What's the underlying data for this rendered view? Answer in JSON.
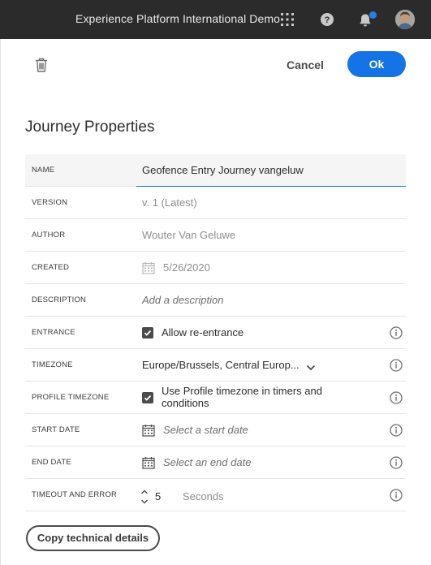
{
  "header": {
    "org_name": "Experience Platform International Demo",
    "icons": [
      "apps-icon",
      "help-icon",
      "bell-icon",
      "avatar"
    ],
    "notification_badge_color": "#2680eb"
  },
  "toolbar": {
    "delete_icon": "trash-icon",
    "cancel_label": "Cancel",
    "ok_label": "Ok",
    "accent_color": "#1473e6"
  },
  "page_title": "Journey Properties",
  "properties": {
    "name": {
      "label": "NAME",
      "value": "Geofence Entry Journey vangeluw"
    },
    "version": {
      "label": "VERSION",
      "value": "v. 1 (Latest)"
    },
    "author": {
      "label": "AUTHOR",
      "value": "Wouter Van Geluwe"
    },
    "created": {
      "label": "CREATED",
      "value": "5/26/2020"
    },
    "description": {
      "label": "DESCRIPTION",
      "placeholder": "Add a description"
    },
    "entrance": {
      "label": "ENTRANCE",
      "checkbox_label": "Allow re-entrance",
      "checked": true
    },
    "timezone": {
      "label": "TIMEZONE",
      "value": "Europe/Brussels, Central Europ..."
    },
    "profile_timezone": {
      "label": "PROFILE TIMEZONE",
      "checkbox_label": "Use Profile timezone in timers and conditions",
      "checked": true
    },
    "start_date": {
      "label": "START DATE",
      "placeholder": "Select a start date"
    },
    "end_date": {
      "label": "END DATE",
      "placeholder": "Select an end date"
    },
    "timeout": {
      "label": "TIMEOUT AND ERROR",
      "value": "5",
      "unit": "Seconds"
    }
  },
  "footer": {
    "copy_label": "Copy technical details"
  }
}
